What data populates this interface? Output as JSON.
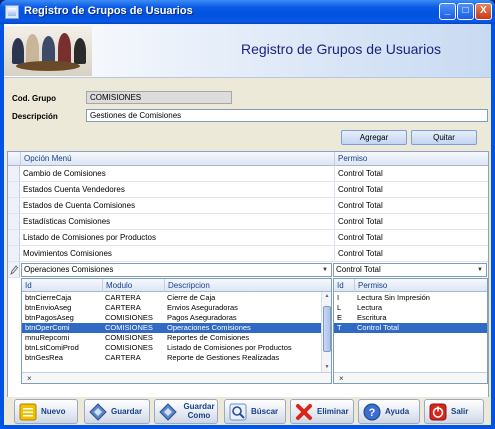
{
  "window": {
    "title": "Registro de Grupos de Usuarios",
    "minimize_glyph": "_",
    "maximize_glyph": "□",
    "close_glyph": "X"
  },
  "header": {
    "title": "Registro de Grupos de Usuarios"
  },
  "form": {
    "cod_grupo_label": "Cod. Grupo",
    "cod_grupo_value": "COMISIONES",
    "descripcion_label": "Descripción",
    "descripcion_value": "Gestiones de Comisiones"
  },
  "actions": {
    "agregar": "Agregar",
    "quitar": "Quitar"
  },
  "grid": {
    "columns": [
      "Opción Menú",
      "Permiso"
    ],
    "rows": [
      [
        "Cambio de Comisiones",
        "Control Total"
      ],
      [
        "Estados Cuenta Vendedores",
        "Control Total"
      ],
      [
        "Estados de Cuenta Comisiones",
        "Control Total"
      ],
      [
        "Estadísticas Comisiones",
        "Control Total"
      ],
      [
        "Listado de Comisiones por Productos",
        "Control Total"
      ],
      [
        "Movimientos Comisiones",
        "Control Total"
      ]
    ],
    "edit_row": {
      "opcion": "Operaciones Comisiones",
      "permiso": "Control Total"
    }
  },
  "menu_dropdown": {
    "columns": [
      "Id",
      "Modulo",
      "Descripcion"
    ],
    "rows": [
      [
        "btnCierreCaja",
        "CARTERA",
        "Cierre de Caja"
      ],
      [
        "btnEnvioAseg",
        "CARTERA",
        "Envios Aseguradoras"
      ],
      [
        "btnPagosAseg",
        "COMISIONES",
        "Pagos Aseguradoras"
      ],
      [
        "btnOperComi",
        "COMISIONES",
        "Operaciones Comisiones"
      ],
      [
        "mnuRepcomi",
        "COMISIONES",
        "Reportes de Comisiones"
      ],
      [
        "btnLstComiProd",
        "COMISIONES",
        "Listado de Comisiones por Productos"
      ],
      [
        "btnGesRea",
        "CARTERA",
        "Reporte de Gestiones Realizadas"
      ]
    ],
    "selected_index": 3,
    "footer_glyph": "×"
  },
  "permiso_dropdown": {
    "columns": [
      "Id",
      "Permiso"
    ],
    "rows": [
      [
        "I",
        "Lectura Sin Impresión"
      ],
      [
        "L",
        "Lectura"
      ],
      [
        "E",
        "Escritura"
      ],
      [
        "T",
        "Control Total"
      ]
    ],
    "selected_index": 3,
    "footer_glyph": "×"
  },
  "toolbar": {
    "nuevo": "Nuevo",
    "guardar": "Guardar",
    "guardar_como_1": "Guardar",
    "guardar_como_2": "Como",
    "buscar": "Búscar",
    "eliminar": "Eliminar",
    "ayuda": "Ayuda",
    "salir": "Salir"
  }
}
